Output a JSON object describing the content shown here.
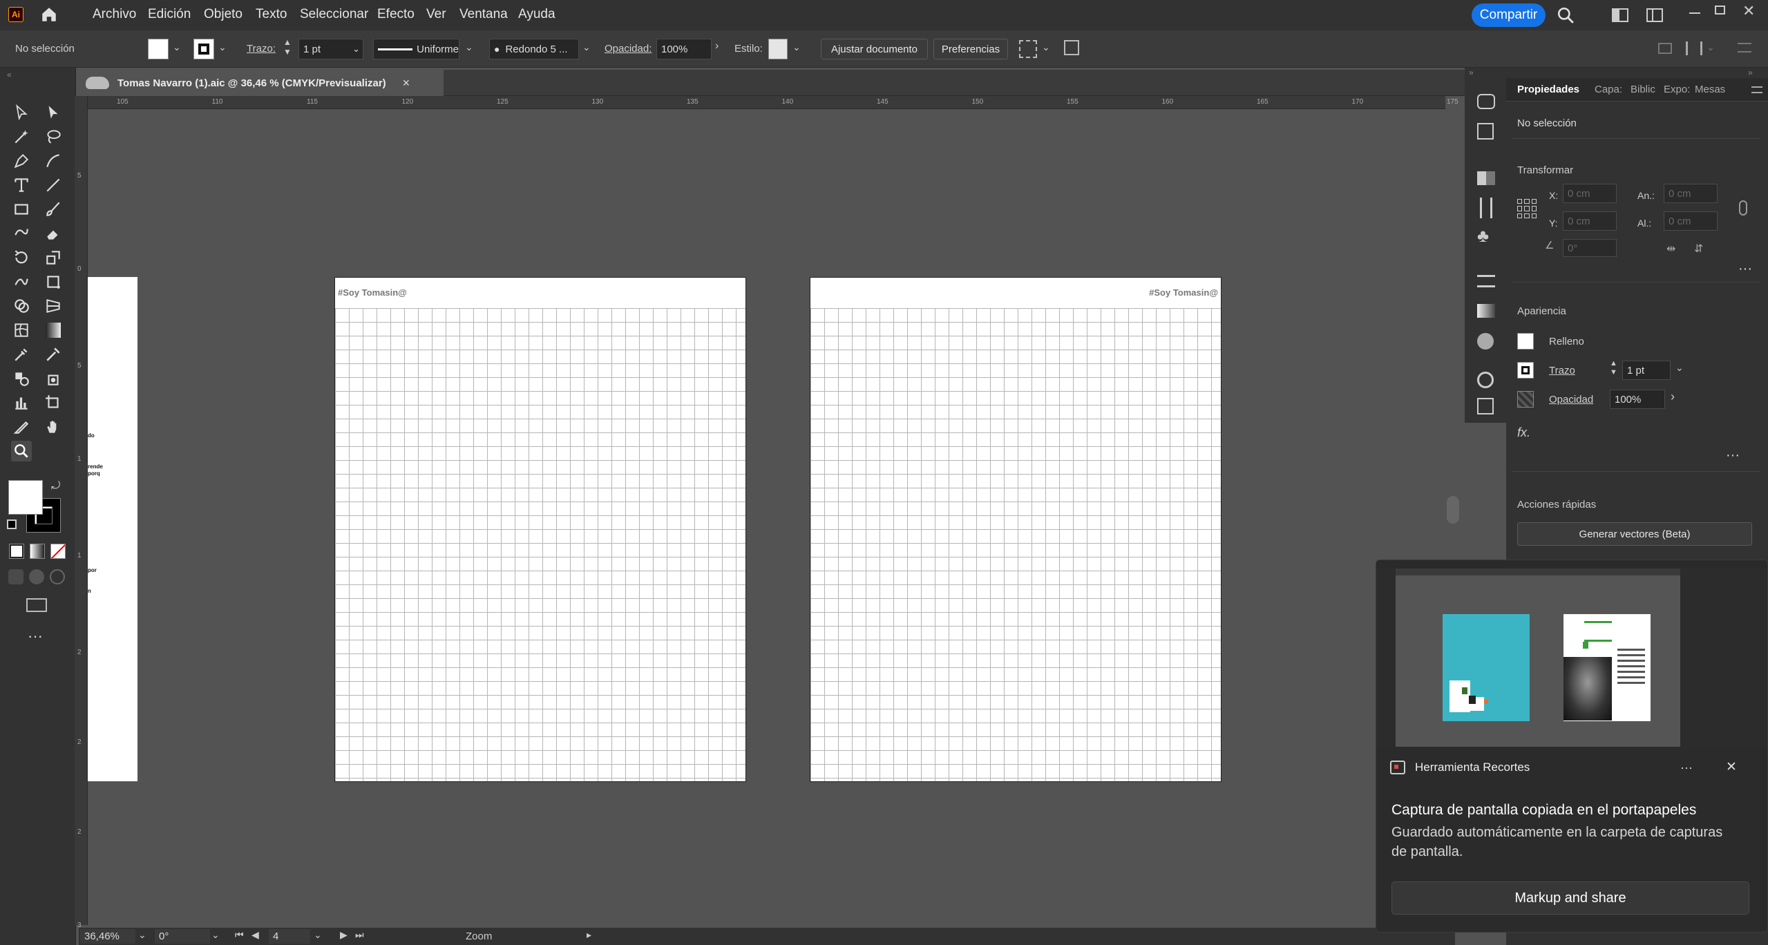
{
  "app": {
    "logo": "Ai",
    "home_icon": "home-icon"
  },
  "menu": [
    "Archivo",
    "Edición",
    "Objeto",
    "Texto",
    "Seleccionar",
    "Efecto",
    "Ver",
    "Ventana",
    "Ayuda"
  ],
  "share_label": "Compartir",
  "control": {
    "selection_state": "No selección",
    "stroke_label": "Trazo:",
    "stroke_weight": "1 pt",
    "profile": "Uniforme",
    "brush": "Redondo 5 ...",
    "opacity_label": "Opacidad:",
    "opacity_value": "100%",
    "style_label": "Estilo:",
    "fit_doc": "Ajustar documento",
    "prefs": "Preferencias"
  },
  "doc_tab": {
    "title": "Tomas Navarro (1).aic @ 36,46 % (CMYK/Previsualizar)",
    "close": "×"
  },
  "ruler_ticks": [
    "105",
    "110",
    "115",
    "120",
    "125",
    "130",
    "135",
    "140",
    "145",
    "150",
    "155",
    "160",
    "165",
    "170",
    "175"
  ],
  "artboards": {
    "left_label": "#Soy Tomasin@",
    "right_label": "#Soy Tomasin@"
  },
  "partial_artboard_text": [
    "do",
    "rende",
    "porq",
    "por",
    "n"
  ],
  "status": {
    "zoom": "36,46%",
    "rotation": "0°",
    "artboard_num": "4",
    "tool": "Zoom"
  },
  "panel": {
    "tabs": [
      "Propiedades",
      "Capa:",
      "Biblic",
      "Expo:",
      "Mesas"
    ],
    "no_selection": "No selección",
    "transform_title": "Transformar",
    "x_label": "X:",
    "x_value": "0 cm",
    "y_label": "Y:",
    "y_value": "0 cm",
    "w_label": "An.:",
    "w_value": "0 cm",
    "h_label": "Al.:",
    "h_value": "0 cm",
    "angle_value": "0°",
    "appearance_title": "Apariencia",
    "fill_label": "Relleno",
    "stroke_label": "Trazo",
    "stroke_value": "1 pt",
    "opacity_label": "Opacidad",
    "opacity_value": "100%",
    "fx_label": "fx.",
    "quick_actions_title": "Acciones rápidas",
    "generate_vectors": "Generar vectores (Beta)"
  },
  "toast": {
    "app_name": "Herramienta Recortes",
    "more": "···",
    "close": "✕",
    "title": "Captura de pantalla copiada en el portapapeles",
    "body": "Guardado automáticamente en la carpeta de capturas de pantalla.",
    "action": "Markup and share"
  },
  "colors": {
    "accent": "#1473e6",
    "ai_logo_bg": "#330000",
    "ai_logo_fg": "#ff9a00",
    "toast_thumb_teal": "#3bb5c4"
  }
}
